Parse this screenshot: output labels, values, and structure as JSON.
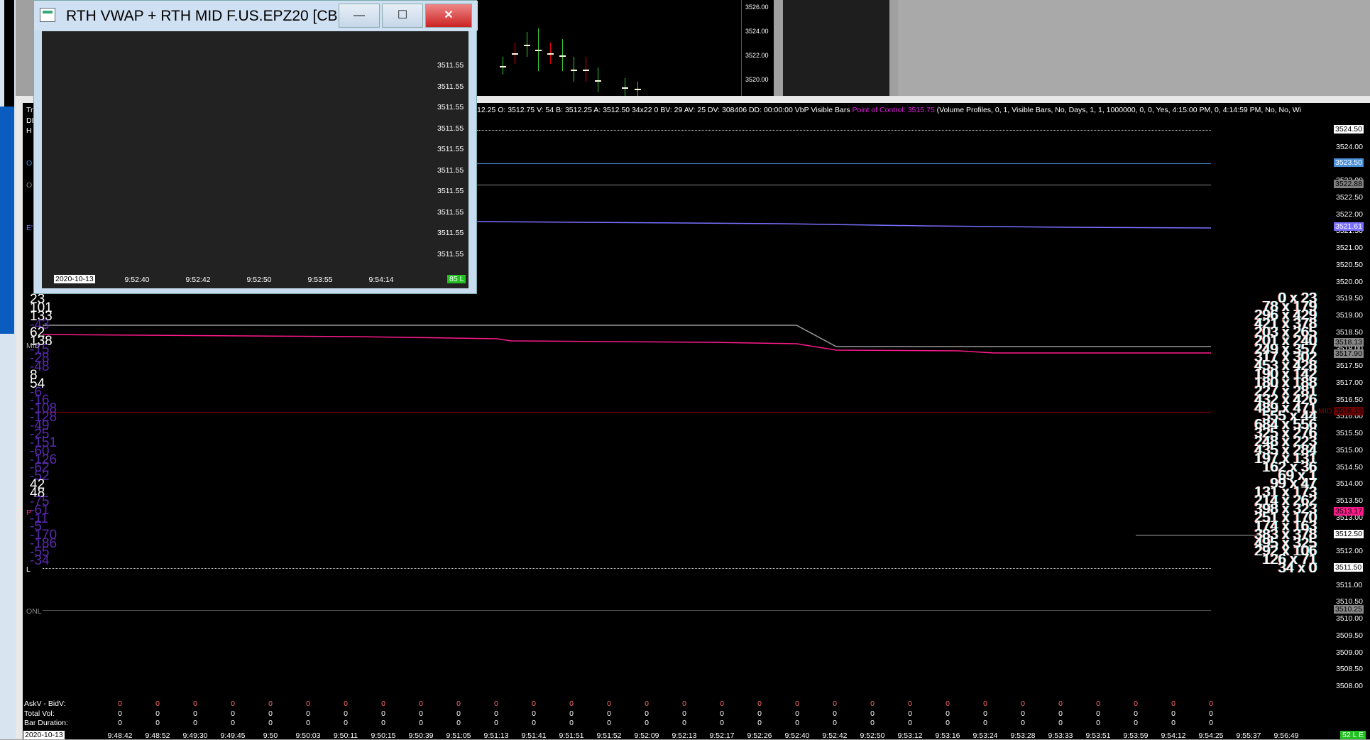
{
  "floating_window": {
    "title": "RTH VWAP + RTH MID  F.US.EPZ20 [CB...",
    "price_labels": [
      "3511.55",
      "3511.55",
      "3511.55",
      "3511.55",
      "3511.55",
      "3511.55",
      "3511.55",
      "3511.55",
      "3511.55",
      "3511.55"
    ],
    "date": "2020-10-13",
    "times": [
      "9:52:40",
      "9:52:42",
      "9:52:50",
      "9:53:55",
      "9:54:14"
    ],
    "status": "85 L",
    "buttons": {
      "minimize": "—",
      "maximize": "☐",
      "close": "✕"
    }
  },
  "top_chart": {
    "price_labels": [
      "3526.00",
      "3524.00",
      "3522.00",
      "3520.00"
    ]
  },
  "left_labels": [
    "Tr",
    "DI",
    "H",
    "O",
    "O",
    "E'",
    "MID",
    "P",
    "L",
    "ONL"
  ],
  "info_line": {
    "text": "12.25 O: 3512.75 V: 54 B: 3512.25 A: 3512.50 34x22 0 BV: 29 AV: 25 DV: 308406 DD: 00:00:00 VbP Visible Bars",
    "poc": "Point of Control: 3515.75",
    "params": "(Volume Profiles, 0, 1, Visible Bars, No, Days, 1, 1, 1000000, 0, 0, Yes, 4:15:00 PM, 0, 4:14:59 PM, No, No, Wi"
  },
  "price_axis": [
    "3524.50",
    "3524.00",
    "3523.50",
    "3523.00",
    "3522.50",
    "3522.00",
    "3521.50",
    "3521.00",
    "3520.50",
    "3520.00",
    "3519.50",
    "3519.00",
    "3518.50",
    "3518.00",
    "3517.50",
    "3517.00",
    "3516.50",
    "3516.00",
    "3515.50",
    "3515.00",
    "3514.50",
    "3514.00",
    "3513.50",
    "3513.00",
    "3512.50",
    "3512.00",
    "3511.50",
    "3511.00",
    "3510.50",
    "3510.00",
    "3509.50",
    "3509.00",
    "3508.50",
    "3508.00"
  ],
  "price_tags": [
    {
      "text": "3524.50",
      "price": 3524.5,
      "bg": "#ffffff",
      "fg": "#000000"
    },
    {
      "text": "3523.50",
      "price": 3523.5,
      "bg": "#4a90d9",
      "fg": "#ffffff"
    },
    {
      "text": "3522.88",
      "price": 3522.88,
      "bg": "#808080",
      "fg": "#000000"
    },
    {
      "text": "3521.61",
      "price": 3521.61,
      "bg": "#7a70ff",
      "fg": "#ffffff"
    },
    {
      "text": "3518.13",
      "price": 3518.18,
      "bg": "#888888",
      "fg": "#000000"
    },
    {
      "text": "3517.90",
      "price": 3517.85,
      "bg": "#888888",
      "fg": "#000000"
    },
    {
      "text": "3516.13",
      "price": 3516.13,
      "bg": "#6a0000",
      "fg": "#000000"
    },
    {
      "text": "3513.17",
      "price": 3513.17,
      "bg": "#ff1a8c",
      "fg": "#000000"
    },
    {
      "text": "3512.50",
      "price": 3512.5,
      "bg": "#ffffff",
      "fg": "#000000"
    },
    {
      "text": "3511.50",
      "price": 3511.5,
      "bg": "#ffffff",
      "fg": "#000000"
    },
    {
      "text": "3510.25",
      "price": 3510.25,
      "bg": "#888888",
      "fg": "#000000"
    }
  ],
  "ymid_label": "yMID",
  "volume_profile": [
    "0 x 23",
    "78 x 179",
    "296 x 429",
    "421 x 378",
    "203 x 265",
    "201 x 240",
    "249 x 357",
    "317 x 302",
    "453 x 428",
    "190 x 142",
    "180 x 188",
    "227 x 281",
    "432 x 426",
    "489 x 471",
    "555 x 44",
    "684 x 556",
    "325 x 276",
    "248 x 223",
    "435 x 284",
    "197 x 131",
    "162 x 36",
    "69 x 1",
    "99 x 47",
    "131 x 173",
    "214 x 262",
    "398 x 323",
    "251 x 170",
    "174 x 163",
    "383 x 378",
    "495 x 325",
    "292 x 106",
    "126 x 71",
    "34 x 0"
  ],
  "deltas": [
    {
      "t": "23",
      "c": "#fff"
    },
    {
      "t": "101",
      "c": "#fff"
    },
    {
      "t": "133",
      "c": "#fff"
    },
    {
      "t": "-43",
      "c": "#5a2ab0"
    },
    {
      "t": "62",
      "c": "#fff"
    },
    {
      "t": "138",
      "c": "#fff"
    },
    {
      "t": "-15",
      "c": "#5a2ab0"
    },
    {
      "t": "-28",
      "c": "#5a2ab0"
    },
    {
      "t": "-48",
      "c": "#5a2ab0"
    },
    {
      "t": "8",
      "c": "#fff"
    },
    {
      "t": "54",
      "c": "#fff"
    },
    {
      "t": "-6",
      "c": "#5a2ab0"
    },
    {
      "t": "-16",
      "c": "#5a2ab0"
    },
    {
      "t": "-108",
      "c": "#5a2ab0"
    },
    {
      "t": "-128",
      "c": "#5a2ab0"
    },
    {
      "t": "-49",
      "c": "#5a2ab0"
    },
    {
      "t": "-25",
      "c": "#5a2ab0"
    },
    {
      "t": "-151",
      "c": "#5a2ab0"
    },
    {
      "t": "-60",
      "c": "#5a2ab0"
    },
    {
      "t": "-126",
      "c": "#5a2ab0"
    },
    {
      "t": "-62",
      "c": "#5a2ab0"
    },
    {
      "t": "-52",
      "c": "#5a2ab0"
    },
    {
      "t": "42",
      "c": "#fff"
    },
    {
      "t": "48",
      "c": "#fff"
    },
    {
      "t": "-75",
      "c": "#5a2ab0"
    },
    {
      "t": "-61",
      "c": "#5a2ab0"
    },
    {
      "t": "-11",
      "c": "#5a2ab0"
    },
    {
      "t": "-5",
      "c": "#5a2ab0"
    },
    {
      "t": "-170",
      "c": "#5a2ab0"
    },
    {
      "t": "-186",
      "c": "#5a2ab0"
    },
    {
      "t": "-55",
      "c": "#5a2ab0"
    },
    {
      "t": "-34",
      "c": "#5a2ab0"
    }
  ],
  "bottom_rows": {
    "labels": [
      "AskV - BidV:",
      "Total Vol:",
      "Bar Duration:"
    ],
    "columns": 30,
    "value": "0"
  },
  "time_axis": {
    "date": "2020-10-13",
    "times": [
      "9:48:42",
      "9:48:52",
      "9:49:30",
      "9:49:45",
      "9:50",
      "9:50:03",
      "9:50:11",
      "9:50:15",
      "9:50:39",
      "9:51:05",
      "9:51:13",
      "9:51:41",
      "9:51:51",
      "9:51:52",
      "9:52:09",
      "9:52:13",
      "9:52:17",
      "9:52:26",
      "9:52:40",
      "9:52:42",
      "9:52:50",
      "9:53:12",
      "9:53:16",
      "9:53:24",
      "9:53:28",
      "9:53:33",
      "9:53:51",
      "9:53:59",
      "9:54:12",
      "9:54:25",
      "9:55:37",
      "9:56:49"
    ],
    "status": "52 L E"
  },
  "colors": {
    "vwap": "#7a70ff",
    "pink": "#ff1a8c",
    "ymid": "#8b0000",
    "blue": "#4a90d9",
    "status_green": "#22c022"
  }
}
